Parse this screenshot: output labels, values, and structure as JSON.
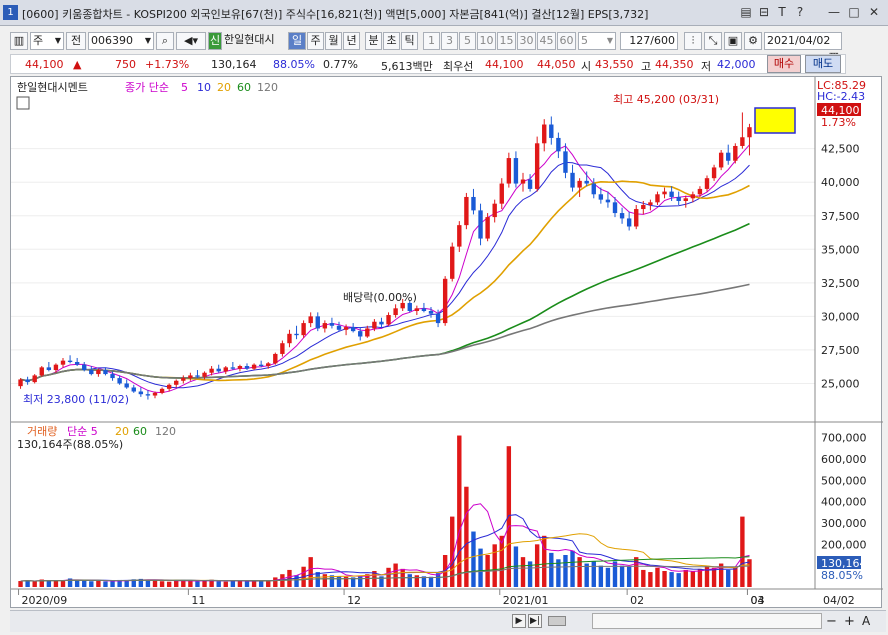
{
  "window": {
    "number": "1",
    "title": "[0600] 키움종합차트 - KOSPI200 외국인보유[67(천)] 주식수[16,821(천)] 액면[5,000] 자본금[841(억)] 결산[12월] EPS[3,732]",
    "buttons": [
      "▤",
      "⊟",
      "T",
      "?",
      "—",
      "□",
      "✕"
    ]
  },
  "toolbar": {
    "type_select": "주",
    "prev_label": "전",
    "code": "006390",
    "sin_label": "신",
    "stock_name": "한일현대시",
    "periods": [
      "일",
      "주",
      "월",
      "년",
      "분",
      "초",
      "틱"
    ],
    "selected_period": "일",
    "intervals": [
      "1",
      "3",
      "5",
      "10",
      "15",
      "30",
      "45",
      "60",
      "5"
    ],
    "count": "127/600",
    "date": "2021/04/02"
  },
  "quote": {
    "price": "44,100",
    "arrow": "▲",
    "change": "750",
    "change_pct": "+1.73%",
    "volume": "130,164",
    "vol_ratio": "88.05%",
    "turnover": "0.77%",
    "amount": "5,613백만",
    "pref_label": "최우선",
    "ask": "44,100",
    "bid": "44,050",
    "open_label": "시",
    "open": "43,550",
    "high_label": "고",
    "high": "44,350",
    "low_label": "저",
    "low": "42,000",
    "buy_label": "매수",
    "sell_label": "매도"
  },
  "price_panel": {
    "stock_label": "한일현대시멘트",
    "legend": [
      {
        "text": "종가 단순",
        "color": "#cc00cc"
      },
      {
        "text": "5",
        "color": "#cc00cc"
      },
      {
        "text": "10",
        "color": "#2b2bd6"
      },
      {
        "text": "20",
        "color": "#e0a000"
      },
      {
        "text": "60",
        "color": "#1a8c1a"
      },
      {
        "text": "120",
        "color": "#777777"
      }
    ],
    "lc": "LC:85.29",
    "hc": "HC:-2.43",
    "last_price": "44,100",
    "last_pct": "1.73%",
    "high_note": "최고 45,200 (03/31)",
    "low_note": "최저 23,800 (11/02)",
    "dividend_note": "배당락(0.00%)",
    "y_ticks": [
      "42,500",
      "40,000",
      "37,500",
      "35,000",
      "32,500",
      "30,000",
      "27,500",
      "25,000"
    ]
  },
  "volume_panel": {
    "legend": [
      {
        "text": "거래량",
        "color": "#e06020"
      },
      {
        "text": "단순 5",
        "color": "#cc00cc"
      },
      {
        "text": "20",
        "color": "#e0a000"
      },
      {
        "text": "60",
        "color": "#1a8c1a"
      },
      {
        "text": "120",
        "color": "#777777"
      }
    ],
    "current": "130,164주(88.05%)",
    "last_volume": "130,164",
    "last_pct": "88.05%",
    "y_ticks": [
      "700,000",
      "600,000",
      "500,000",
      "400,000",
      "300,000",
      "200,000"
    ]
  },
  "x_axis": {
    "labels": [
      "2020/09",
      "11",
      "12",
      "2021/01",
      "02",
      "03",
      "04"
    ],
    "right_label": "04/02"
  },
  "chart_data": {
    "type": "candlestick",
    "ylim_price": [
      22500,
      46500
    ],
    "ylim_volume": [
      0,
      750000
    ],
    "candles": [
      [
        24800,
        25400,
        24600,
        25300
      ],
      [
        25300,
        25500,
        24900,
        25100
      ],
      [
        25100,
        25700,
        25000,
        25600
      ],
      [
        25600,
        26300,
        25500,
        26200
      ],
      [
        26200,
        26600,
        25900,
        26000
      ],
      [
        26000,
        26500,
        25800,
        26400
      ],
      [
        26400,
        26900,
        26200,
        26700
      ],
      [
        26700,
        27100,
        26500,
        26600
      ],
      [
        26600,
        26900,
        26300,
        26400
      ],
      [
        26400,
        26600,
        25900,
        26000
      ],
      [
        26000,
        26300,
        25600,
        25700
      ],
      [
        25700,
        26100,
        25500,
        26000
      ],
      [
        26000,
        26200,
        25600,
        25700
      ],
      [
        25700,
        25900,
        25200,
        25400
      ],
      [
        25400,
        25600,
        24900,
        25000
      ],
      [
        25000,
        25300,
        24600,
        24700
      ],
      [
        24700,
        24900,
        24300,
        24400
      ],
      [
        24400,
        24700,
        24000,
        24200
      ],
      [
        24200,
        24500,
        23800,
        24100
      ],
      [
        24100,
        24400,
        23900,
        24300
      ],
      [
        24300,
        24700,
        24200,
        24600
      ],
      [
        24600,
        25000,
        24400,
        24900
      ],
      [
        24900,
        25300,
        24700,
        25200
      ],
      [
        25200,
        25600,
        25000,
        25400
      ],
      [
        25400,
        25800,
        25200,
        25600
      ],
      [
        25600,
        26000,
        25400,
        25500
      ],
      [
        25500,
        25900,
        25300,
        25800
      ],
      [
        25800,
        26300,
        25600,
        26100
      ],
      [
        26100,
        26400,
        25800,
        25900
      ],
      [
        25900,
        26300,
        25700,
        26200
      ],
      [
        26200,
        26600,
        26000,
        26100
      ],
      [
        26100,
        26400,
        25900,
        26300
      ],
      [
        26300,
        26500,
        26000,
        26100
      ],
      [
        26100,
        26500,
        26000,
        26400
      ],
      [
        26400,
        26700,
        26200,
        26300
      ],
      [
        26300,
        26600,
        26100,
        26500
      ],
      [
        26500,
        27300,
        26400,
        27200
      ],
      [
        27200,
        28200,
        27000,
        28000
      ],
      [
        28000,
        29000,
        27700,
        28700
      ],
      [
        28700,
        29300,
        28300,
        28600
      ],
      [
        28600,
        29700,
        28400,
        29500
      ],
      [
        29500,
        30300,
        29200,
        30000
      ],
      [
        30000,
        30300,
        28900,
        29100
      ],
      [
        29100,
        29700,
        28800,
        29500
      ],
      [
        29500,
        29900,
        29100,
        29300
      ],
      [
        29300,
        29600,
        28900,
        29000
      ],
      [
        29000,
        29400,
        28600,
        29200
      ],
      [
        29200,
        29500,
        28800,
        28900
      ],
      [
        28900,
        29200,
        28200,
        28500
      ],
      [
        28500,
        29300,
        28400,
        29100
      ],
      [
        29100,
        29800,
        28900,
        29600
      ],
      [
        29600,
        29900,
        29200,
        29400
      ],
      [
        29400,
        30300,
        29300,
        30100
      ],
      [
        30100,
        30900,
        29900,
        30600
      ],
      [
        30600,
        31300,
        30400,
        31000
      ],
      [
        31000,
        31200,
        30300,
        30400
      ],
      [
        30400,
        30800,
        30100,
        30600
      ],
      [
        30600,
        31000,
        30300,
        30400
      ],
      [
        30400,
        30700,
        29900,
        30200
      ],
      [
        30200,
        30500,
        29200,
        29500
      ],
      [
        29500,
        33000,
        29300,
        32800
      ],
      [
        32800,
        35500,
        32600,
        35200
      ],
      [
        35200,
        37100,
        34800,
        36800
      ],
      [
        36800,
        39200,
        36500,
        38900
      ],
      [
        38900,
        39500,
        37600,
        37900
      ],
      [
        37900,
        38400,
        35300,
        35800
      ],
      [
        35800,
        37700,
        35600,
        37400
      ],
      [
        37400,
        38700,
        37000,
        38400
      ],
      [
        38400,
        40300,
        38000,
        39900
      ],
      [
        39900,
        42200,
        39600,
        41800
      ],
      [
        41800,
        42300,
        39600,
        39900
      ],
      [
        39900,
        40700,
        39300,
        40200
      ],
      [
        40200,
        40600,
        39300,
        39500
      ],
      [
        39500,
        43400,
        39300,
        42900
      ],
      [
        42900,
        44700,
        42300,
        44300
      ],
      [
        44300,
        44900,
        42800,
        43300
      ],
      [
        43300,
        43700,
        41800,
        42300
      ],
      [
        42300,
        42900,
        40300,
        40700
      ],
      [
        40700,
        41300,
        39300,
        39600
      ],
      [
        39600,
        40300,
        38900,
        40100
      ],
      [
        40100,
        40800,
        39700,
        39900
      ],
      [
        39900,
        40300,
        38800,
        39100
      ],
      [
        39100,
        39600,
        38400,
        38700
      ],
      [
        38700,
        39300,
        38100,
        38500
      ],
      [
        38500,
        38900,
        37400,
        37700
      ],
      [
        37700,
        38100,
        36900,
        37300
      ],
      [
        37300,
        37800,
        36400,
        36700
      ],
      [
        36700,
        38300,
        36500,
        38000
      ],
      [
        38000,
        38600,
        37600,
        38300
      ],
      [
        38300,
        38700,
        37900,
        38500
      ],
      [
        38500,
        39300,
        38300,
        39100
      ],
      [
        39100,
        39600,
        38800,
        39300
      ],
      [
        39300,
        39700,
        38600,
        38900
      ],
      [
        38900,
        39300,
        38300,
        38600
      ],
      [
        38600,
        39000,
        38100,
        38800
      ],
      [
        38800,
        39300,
        38500,
        39100
      ],
      [
        39100,
        39700,
        38900,
        39500
      ],
      [
        39500,
        40500,
        39300,
        40300
      ],
      [
        40300,
        41300,
        40100,
        41100
      ],
      [
        41100,
        42400,
        40900,
        42200
      ],
      [
        42200,
        42800,
        41300,
        41600
      ],
      [
        41600,
        42900,
        41400,
        42700
      ],
      [
        42700,
        45200,
        42500,
        43350
      ],
      [
        43350,
        44350,
        42000,
        44100
      ]
    ],
    "volumes": [
      28000,
      30000,
      26000,
      35000,
      32000,
      29000,
      31000,
      40000,
      34000,
      30000,
      27000,
      29000,
      26000,
      28000,
      33000,
      30000,
      36000,
      38000,
      35000,
      31000,
      27000,
      25000,
      29000,
      33000,
      28000,
      26000,
      30000,
      34000,
      27000,
      25000,
      29000,
      31000,
      26000,
      28000,
      27000,
      30000,
      45000,
      60000,
      80000,
      55000,
      95000,
      140000,
      70000,
      60000,
      55000,
      50000,
      48000,
      45000,
      52000,
      60000,
      75000,
      50000,
      90000,
      110000,
      85000,
      60000,
      55000,
      50000,
      48000,
      65000,
      150000,
      330000,
      710000,
      470000,
      260000,
      180000,
      150000,
      200000,
      240000,
      660000,
      190000,
      140000,
      120000,
      200000,
      240000,
      160000,
      130000,
      150000,
      170000,
      140000,
      110000,
      120000,
      100000,
      90000,
      120000,
      100000,
      95000,
      140000,
      80000,
      70000,
      90000,
      75000,
      70000,
      65000,
      80000,
      75000,
      85000,
      100000,
      90000,
      110000,
      80000,
      90000,
      330000,
      130164
    ],
    "series": [
      {
        "name": "5",
        "color": "#cc00cc"
      },
      {
        "name": "10",
        "color": "#2b2bd6"
      },
      {
        "name": "20",
        "color": "#e0a000"
      },
      {
        "name": "60",
        "color": "#1a8c1a"
      },
      {
        "name": "120",
        "color": "#777777"
      }
    ]
  }
}
